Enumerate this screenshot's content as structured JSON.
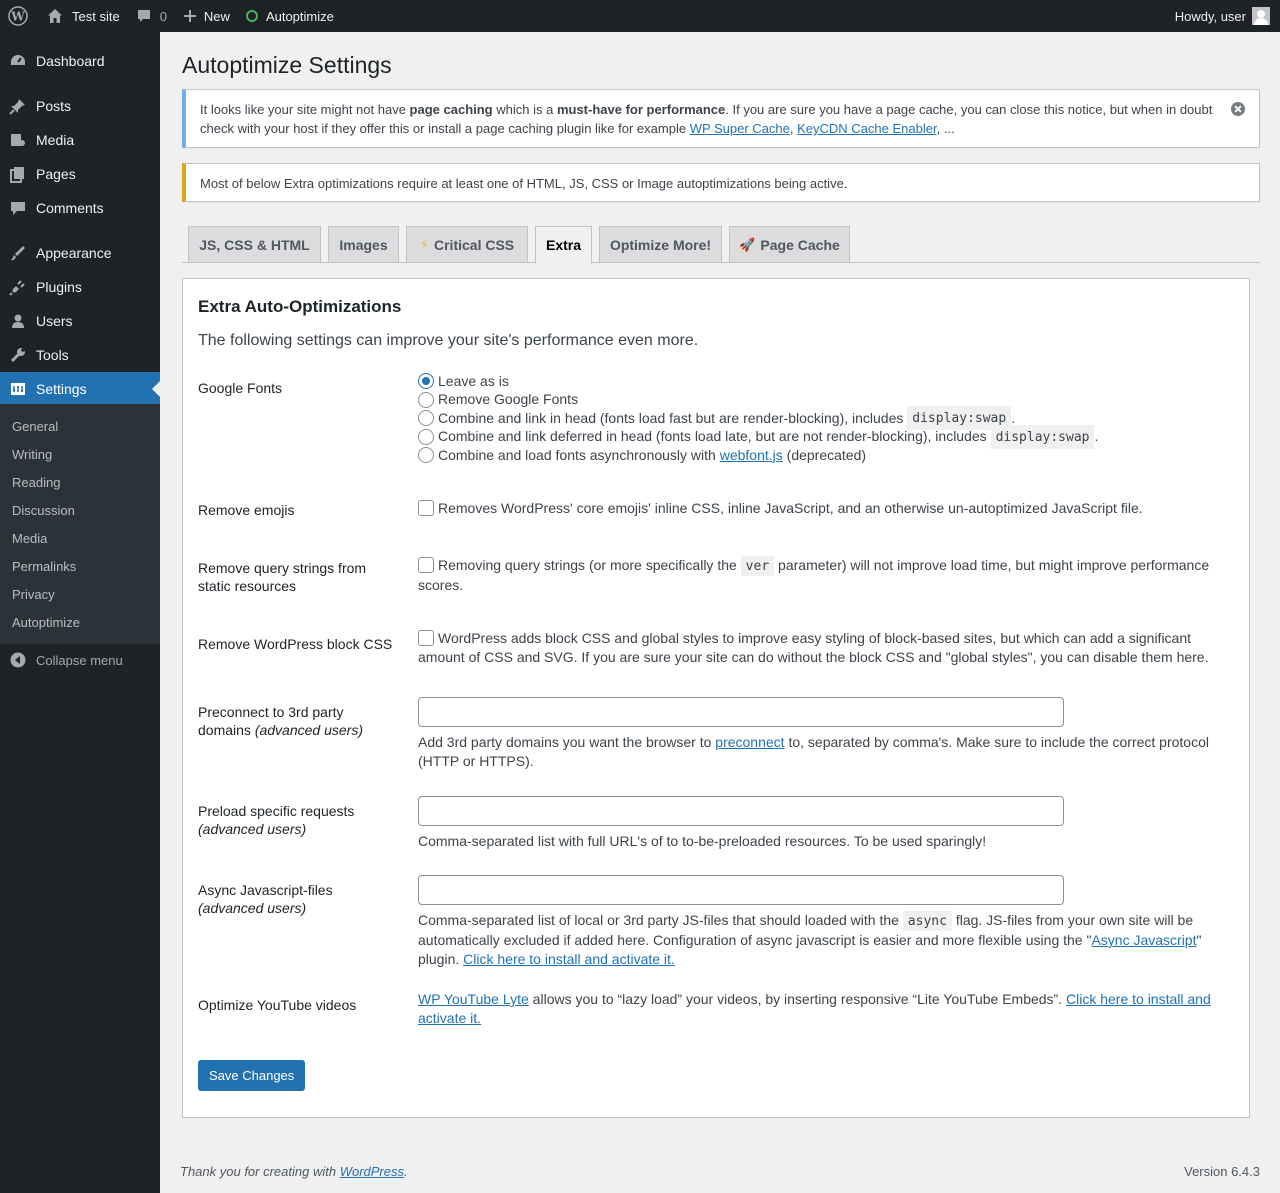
{
  "adminbar": {
    "site_name": "Test site",
    "comments_count": "0",
    "new_label": "New",
    "plugin_label": "Autoptimize",
    "howdy": "Howdy, user"
  },
  "menu": {
    "items": [
      {
        "label": "Dashboard",
        "icon": "dashboard-icon"
      },
      {
        "label": "Posts",
        "icon": "pin-icon"
      },
      {
        "label": "Media",
        "icon": "media-icon"
      },
      {
        "label": "Pages",
        "icon": "pages-icon"
      },
      {
        "label": "Comments",
        "icon": "comment-icon"
      },
      {
        "label": "Appearance",
        "icon": "brush-icon"
      },
      {
        "label": "Plugins",
        "icon": "plug-icon"
      },
      {
        "label": "Users",
        "icon": "user-icon"
      },
      {
        "label": "Tools",
        "icon": "wrench-icon"
      },
      {
        "label": "Settings",
        "icon": "settings-icon"
      }
    ],
    "submenu": [
      "General",
      "Writing",
      "Reading",
      "Discussion",
      "Media",
      "Permalinks",
      "Privacy",
      "Autoptimize"
    ],
    "collapse": "Collapse menu"
  },
  "page": {
    "title": "Autoptimize Settings",
    "notice_info": {
      "t1": "It looks like your site might not have ",
      "b1": "page caching",
      "t2": " which is a ",
      "b2": "must-have for performance",
      "t3": ". If you are sure you have a page cache, you can close this notice, but when in doubt check with your host if they offer this or install a page caching plugin like for example ",
      "link1": "WP Super Cache",
      "sep": ", ",
      "link2": "KeyCDN Cache Enabler",
      "t4": ", ..."
    },
    "notice_warn": "Most of below Extra optimizations require at least one of HTML, JS, CSS or Image autoptimizations being active.",
    "tabs": [
      {
        "label": "JS, CSS & HTML"
      },
      {
        "label": "Images"
      },
      {
        "label": "Critical CSS",
        "icon": "⚡"
      },
      {
        "label": "Extra"
      },
      {
        "label": "Optimize More!"
      },
      {
        "label": "Page Cache",
        "icon": "🚀"
      }
    ],
    "active_tab": "Extra"
  },
  "panel": {
    "heading": "Extra Auto-Optimizations",
    "intro": "The following settings can improve your site's performance even more.",
    "google_fonts": {
      "label": "Google Fonts",
      "options": [
        "Leave as is",
        "Remove Google Fonts",
        "Combine and link in head (fonts load fast but are render-blocking), includes ",
        "Combine and link deferred in head (fonts load late, but are not render-blocking), includes ",
        "Combine and load fonts asynchronously with "
      ],
      "code": "display:swap",
      "webfont_link": "webfont.js",
      "deprecated": " (deprecated)",
      "selected": "Leave as is"
    },
    "emojis": {
      "label": "Remove emojis",
      "text": "Removes WordPress' core emojis' inline CSS, inline JavaScript, and an otherwise un-autoptimized JavaScript file."
    },
    "query": {
      "label": "Remove query strings from static resources",
      "t1": "Removing query strings (or more specifically the ",
      "code": "ver",
      "t2": " parameter) will not improve load time, but might improve performance scores."
    },
    "block_css": {
      "label": "Remove WordPress block CSS",
      "text": "WordPress adds block CSS and global styles to improve easy styling of block-based sites, but which can add a significant amount of CSS and SVG. If you are sure your site can do without the block CSS and \"global styles\", you can disable them here."
    },
    "preconnect": {
      "label": "Preconnect to 3rd party domains ",
      "label_em": "(advanced users)",
      "value": "",
      "d1": "Add 3rd party domains you want the browser to ",
      "link": "preconnect",
      "d2": " to, separated by comma's. Make sure to include the correct protocol (HTTP or HTTPS)."
    },
    "preload": {
      "label": "Preload specific requests ",
      "label_em": "(advanced users)",
      "value": "",
      "desc": "Comma-separated list with full URL's of to to-be-preloaded resources. To be used sparingly!"
    },
    "async": {
      "label": "Async Javascript-files ",
      "label_em": "(advanced users)",
      "value": "",
      "d1": "Comma-separated list of local or 3rd party JS-files that should loaded with the ",
      "code": "async",
      "d2": " flag. JS-files from your own site will be automatically excluded if added here. Configuration of async javascript is easier and more flexible using the \"",
      "link1": "Async Javascript",
      "d3": "\" plugin. ",
      "link2": "Click here to install and activate it."
    },
    "youtube": {
      "label": "Optimize YouTube videos",
      "link1": "WP YouTube Lyte",
      "t1": " allows you to “lazy load” your videos, by inserting responsive “Lite YouTube Embeds”. ",
      "link2": "Click here to install and activate it."
    },
    "save": "Save Changes"
  },
  "footer": {
    "thanks": "Thank you for creating with ",
    "wp_link": "WordPress",
    "dot": ".",
    "version": "Version 6.4.3"
  }
}
